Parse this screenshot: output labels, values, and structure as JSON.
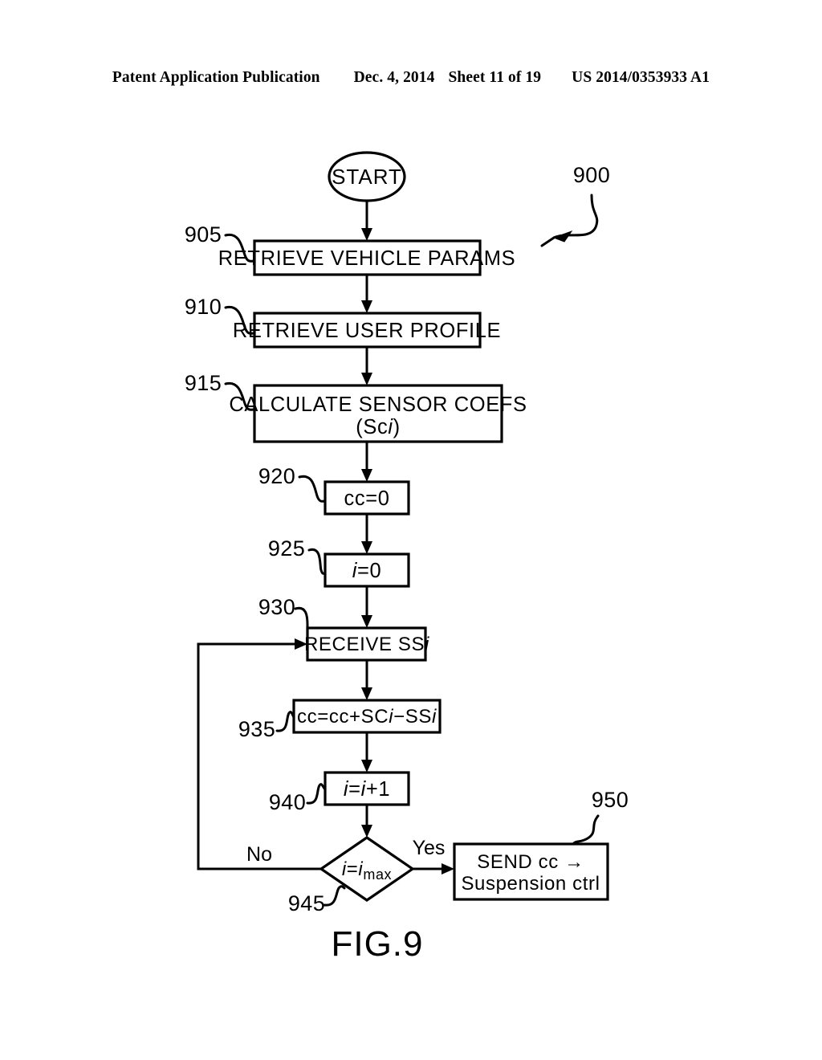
{
  "header": {
    "publication": "Patent Application Publication",
    "date": "Dec. 4, 2014",
    "sheet": "Sheet 11 of 19",
    "patent_number": "US 2014/0353933 A1"
  },
  "figure": {
    "caption": "FIG.9",
    "diagram_reference": "900",
    "start_label": "START",
    "branch_yes": "Yes",
    "branch_no": "No",
    "nodes": [
      {
        "ref": "905",
        "shape": "rect",
        "line1": "RETRIEVE  VEHICLE  PARAMS",
        "line2": ""
      },
      {
        "ref": "910",
        "shape": "rect",
        "line1": "RETRIEVE  USER  PROFILE",
        "line2": ""
      },
      {
        "ref": "915",
        "shape": "rect",
        "line1": "CALCULATE  SENSOR  COEFS",
        "line2": "(Sci)"
      },
      {
        "ref": "920",
        "shape": "rect",
        "line1": "cc=0",
        "line2": ""
      },
      {
        "ref": "925",
        "shape": "rect",
        "line1": "i=0",
        "line2": ""
      },
      {
        "ref": "930",
        "shape": "rect",
        "line1": "RECEIVE  SSi",
        "line2": ""
      },
      {
        "ref": "935",
        "shape": "rect",
        "line1": "cc=cc+SCi−SSi",
        "line2": ""
      },
      {
        "ref": "940",
        "shape": "rect",
        "line1": "i=i+1",
        "line2": ""
      },
      {
        "ref": "945",
        "shape": "diamond",
        "line1": "i=imax",
        "line2": ""
      },
      {
        "ref": "950",
        "shape": "rect",
        "line1": "SEND  cc  →",
        "line2": "Suspension  ctrl"
      }
    ]
  },
  "colors": {
    "ink": "#000000",
    "paper": "#ffffff"
  }
}
